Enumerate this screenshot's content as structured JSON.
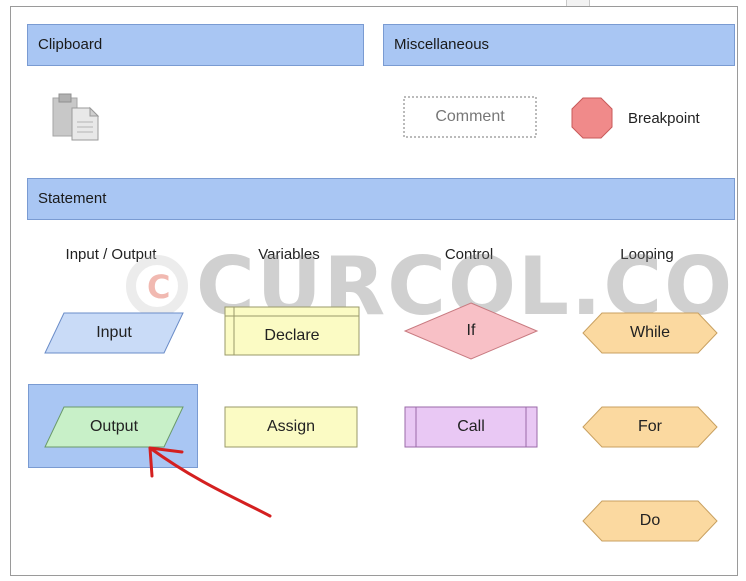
{
  "sections": {
    "clipboard": "Clipboard",
    "miscellaneous": "Miscellaneous",
    "statement": "Statement"
  },
  "misc": {
    "comment": "Comment",
    "breakpoint": "Breakpoint"
  },
  "columns": {
    "io": "Input / Output",
    "variables": "Variables",
    "control": "Control",
    "looping": "Looping"
  },
  "shapes": {
    "input": "Input",
    "output": "Output",
    "declare": "Declare",
    "assign": "Assign",
    "if": "If",
    "call": "Call",
    "while": "While",
    "for": "For",
    "do": "Do"
  },
  "watermark": "CURCOL.CO",
  "colors": {
    "header_bg": "#a9c6f3",
    "input_fill": "#c9dbf7",
    "output_fill": "#c8f0c8",
    "declare_fill": "#fbfbc4",
    "if_fill": "#f8c0c6",
    "call_fill": "#e9c8f4",
    "loop_fill": "#fbd9a0",
    "breakpoint_fill": "#f08a8a",
    "annotation_arrow": "#d42020"
  },
  "icons": {
    "clipboard": "clipboard-icon",
    "breakpoint": "octagon-icon"
  }
}
